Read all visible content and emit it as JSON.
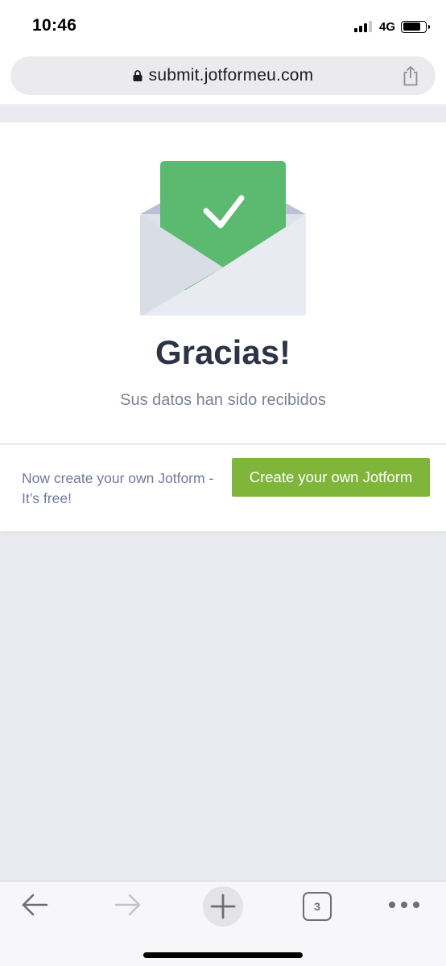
{
  "status_bar": {
    "time": "10:46",
    "network": "4G",
    "signal_bars_active": 3,
    "signal_bars_total": 4,
    "battery_level": 0.8
  },
  "browser": {
    "url": "submit.jotformeu.com",
    "lock_icon": "lock-icon",
    "share_icon": "share-icon"
  },
  "confirmation": {
    "illustration": "envelope-check-icon",
    "title": "Gracias!",
    "subtitle": "Sus datos han sido recibidos"
  },
  "promo": {
    "text_line1": "Now create your own Jotform -",
    "text_line2": "It’s free!",
    "button_label": "Create your own Jotform"
  },
  "toolbar": {
    "items": [
      "back-arrow-icon",
      "forward-arrow-icon",
      "new-tab-plus-icon",
      "tabs-icon",
      "more-dots-icon"
    ],
    "tab_count": "3"
  },
  "colors": {
    "accent_green": "#7fb539",
    "envelope_letter_green": "#5bba6f",
    "title_text": "#2c3345",
    "page_background": "#eaebf0"
  }
}
